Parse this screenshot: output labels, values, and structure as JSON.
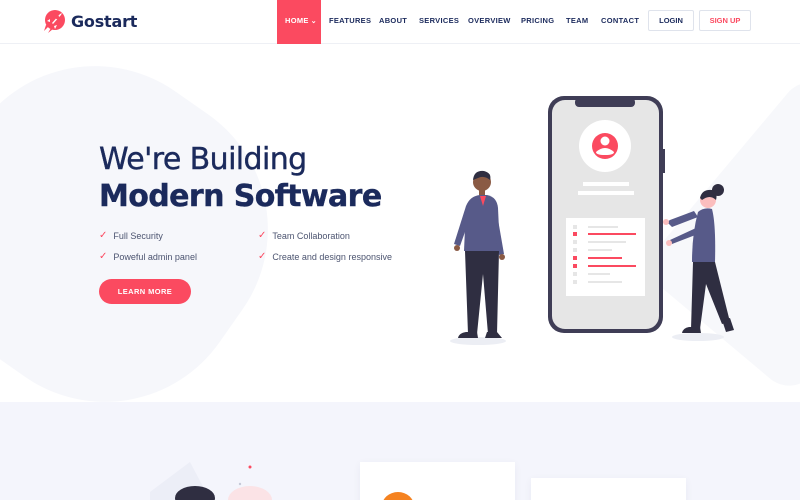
{
  "brand": {
    "name": "Gostart",
    "logo_icon": "rocket-icon",
    "accent": "#fb4a60",
    "navy": "#1b2a5c"
  },
  "nav": {
    "items": [
      {
        "label": "HOME",
        "active": true,
        "has_dropdown": true
      },
      {
        "label": "FEATURES"
      },
      {
        "label": "ABOUT"
      },
      {
        "label": "SERVICES"
      },
      {
        "label": "OVERVIEW"
      },
      {
        "label": "PRICING"
      },
      {
        "label": "TEAM"
      },
      {
        "label": "CONTACT"
      }
    ],
    "login_label": "LOGIN",
    "signup_label": "SIGN UP"
  },
  "hero": {
    "title_line1": "We're Building",
    "title_line2_prefix": "Modern ",
    "title_line2_bold": "Software",
    "features": [
      "Full Security",
      "Team Collaboration",
      "Poweful admin panel",
      "Create and design responsive"
    ],
    "feature_icon": "check-icon",
    "cta_label": "LEARN MORE"
  }
}
